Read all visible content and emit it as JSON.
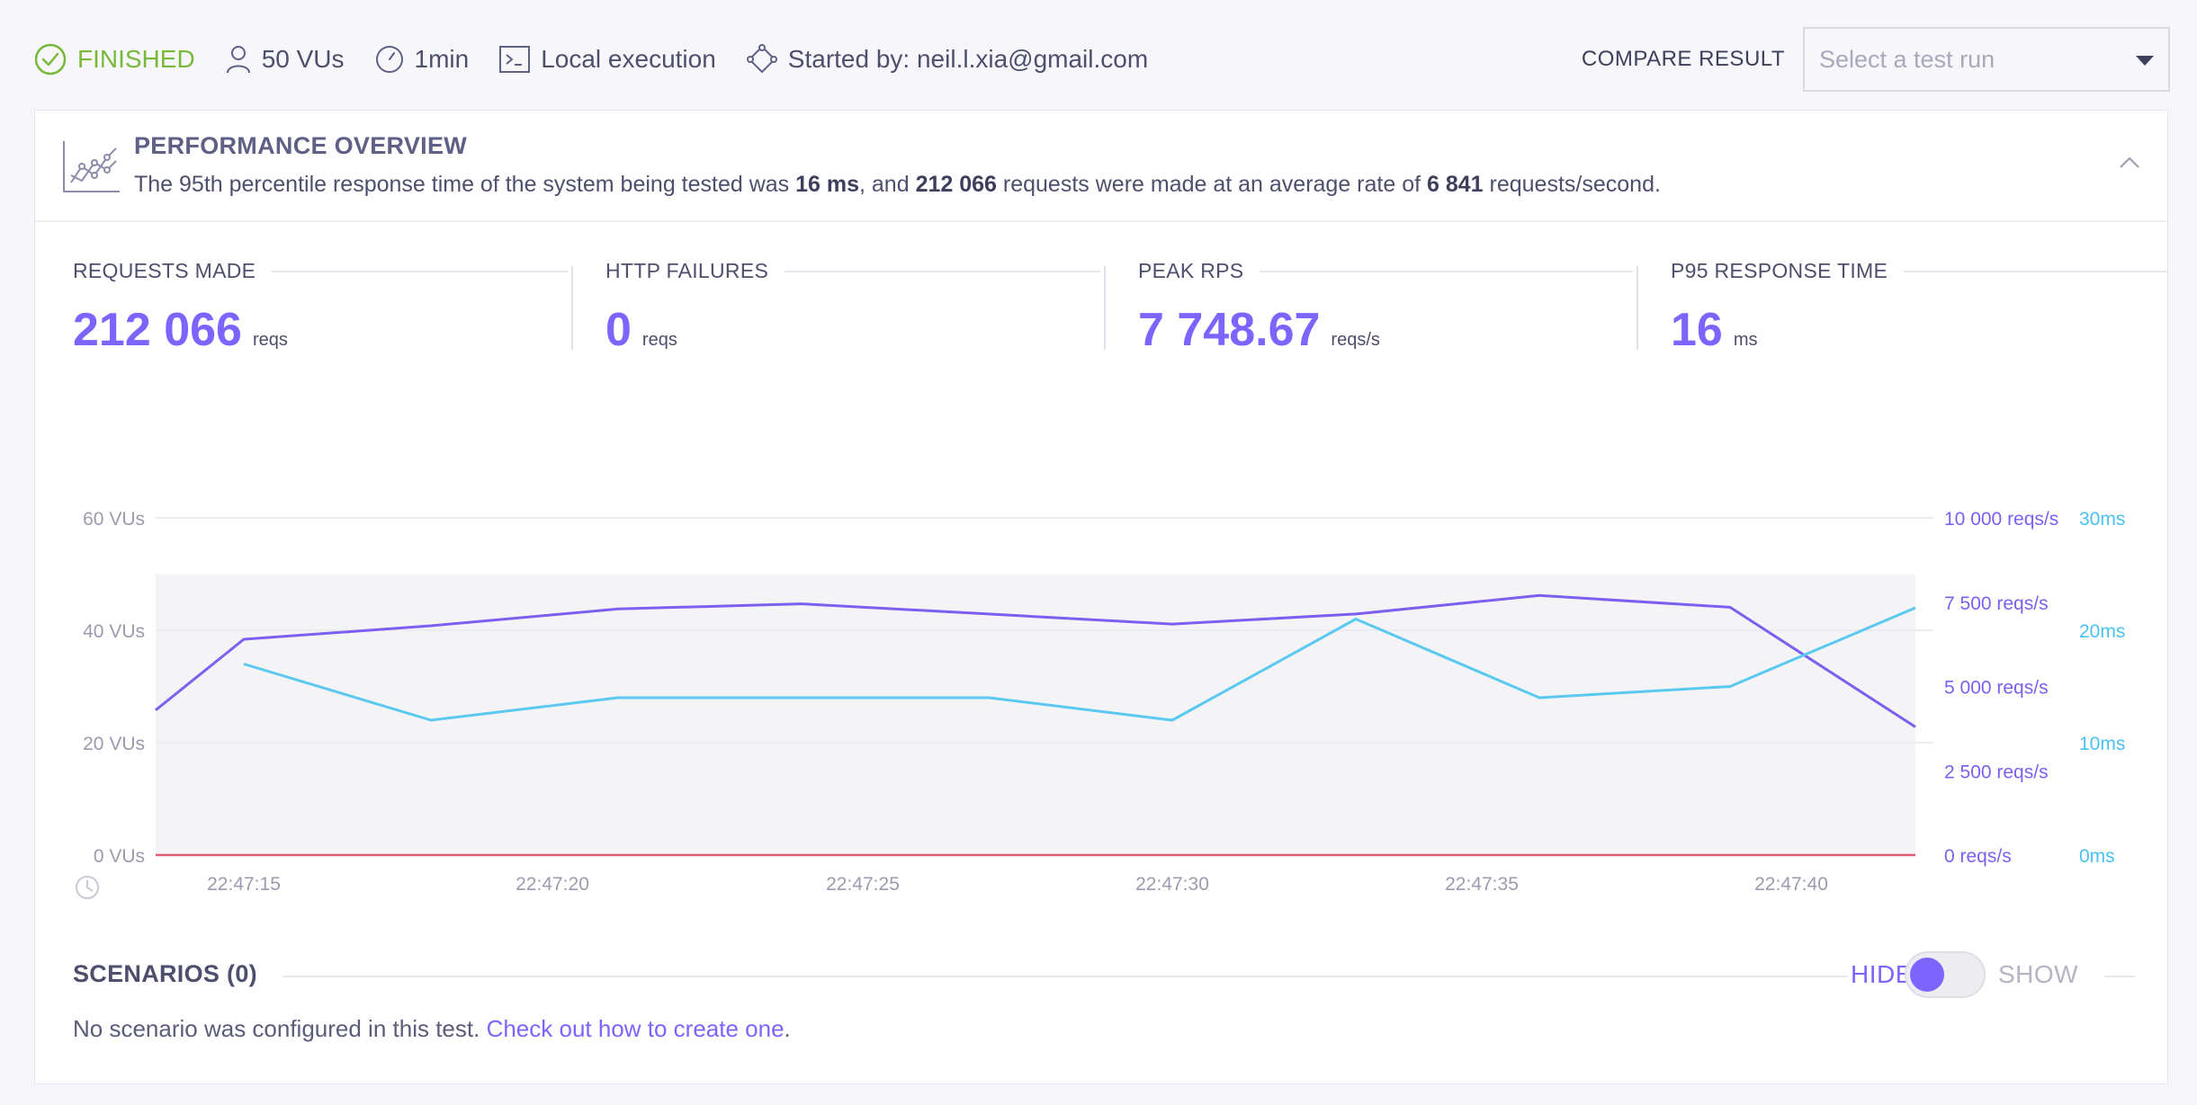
{
  "status": {
    "state": "FINISHED",
    "vus": "50 VUs",
    "duration": "1min",
    "execution": "Local execution",
    "started_by": "Started by: neil.l.xia@gmail.com",
    "state_color": "#79b93a"
  },
  "compare": {
    "label": "COMPARE RESULT",
    "placeholder": "Select a test run"
  },
  "overview": {
    "title": "PERFORMANCE OVERVIEW",
    "desc_prefix": "The 95th percentile response time of the system being tested was ",
    "p95": "16 ms",
    "desc_mid1": ", and ",
    "requests": "212 066",
    "desc_mid2": " requests were made at an average rate of ",
    "rate": "6 841",
    "desc_suffix": " requests/second."
  },
  "metrics": [
    {
      "label": "REQUESTS MADE",
      "value": "212 066",
      "unit": "reqs"
    },
    {
      "label": "HTTP FAILURES",
      "value": "0",
      "unit": "reqs"
    },
    {
      "label": "PEAK RPS",
      "value": "7 748.67",
      "unit": "reqs/s"
    },
    {
      "label": "P95 RESPONSE TIME",
      "value": "16",
      "unit": "ms"
    }
  ],
  "chart_data": {
    "type": "line",
    "x": [
      "22:47:10",
      "22:47:13",
      "22:47:16",
      "22:47:19",
      "22:47:22",
      "22:47:25",
      "22:47:28",
      "22:47:31",
      "22:47:34",
      "22:47:37",
      "22:47:40",
      "22:47:43"
    ],
    "x_tick_labels": [
      "22:47:15",
      "22:47:20",
      "22:47:25",
      "22:47:30",
      "22:47:35",
      "22:47:40"
    ],
    "y_left_ticks": [
      "0 VUs",
      "20 VUs",
      "40 VUs",
      "60 VUs"
    ],
    "y_right1_ticks": [
      "0 reqs/s",
      "2 500 reqs/s",
      "5 000 reqs/s",
      "7 500 reqs/s",
      "10 000 reqs/s"
    ],
    "y_right2_ticks": [
      "0ms",
      "10ms",
      "20ms",
      "30ms"
    ],
    "ylim_left": [
      0,
      60
    ],
    "ylim_rps": [
      0,
      10000
    ],
    "ylim_ms": [
      0,
      30
    ],
    "series": [
      {
        "axis": "vus",
        "values": [
          50,
          50,
          50,
          50,
          50,
          50,
          50,
          50,
          50,
          50,
          50,
          50
        ],
        "color": "#e8e8ee"
      },
      {
        "axis": "rps",
        "values": [
          4300,
          6400,
          6800,
          7300,
          7450,
          7150,
          6850,
          7150,
          7700,
          7350,
          3800
        ],
        "color": "#7d5ff0"
      },
      {
        "axis": "ms",
        "values": [
          17,
          12,
          14,
          14,
          14,
          12,
          21,
          14,
          15,
          22
        ],
        "color": "#5ac8f0"
      },
      {
        "axis": "rps",
        "values": [
          0,
          0
        ],
        "color": "#e05a78"
      }
    ],
    "grid": true,
    "left_color": "#9a9bae",
    "rps_color": "#7d5ff0",
    "ms_color": "#4ac0f0"
  },
  "scenarios": {
    "title": "SCENARIOS (0)",
    "hide_label": "HIDE",
    "show_label": "SHOW",
    "message": "No scenario was configured in this test. ",
    "link": "Check out how to create one",
    "after_link": "."
  }
}
